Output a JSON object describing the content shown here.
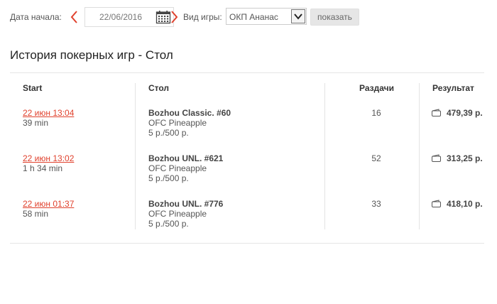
{
  "filter": {
    "start_date_label": "Дата начала:",
    "start_date_value": "22/06/2016",
    "game_type_label": "Вид игры:",
    "game_type_value": "ОКП Ананас",
    "show_button": "показать",
    "accent_color": "#e0412d"
  },
  "page": {
    "title": "История покерных игр - Стол"
  },
  "table": {
    "headers": {
      "start": "Start",
      "table": "Стол",
      "hands": "Раздачи",
      "result": "Результат"
    },
    "rows": [
      {
        "start": "22 июн 13:04",
        "duration": "39 min",
        "table_name": "Bozhou Classic. #60",
        "game": "OFC Pineapple",
        "stakes": "5 р./500 р.",
        "hands": "16",
        "result": "479,39 р."
      },
      {
        "start": "22 июн 13:02",
        "duration": "1 h 34 min",
        "table_name": "Bozhou UNL. #621",
        "game": "OFC Pineapple",
        "stakes": "5 р./500 р.",
        "hands": "52",
        "result": "313,25 р."
      },
      {
        "start": "22 июн 01:37",
        "duration": "58 min",
        "table_name": "Bozhou UNL. #776",
        "game": "OFC Pineapple",
        "stakes": "5 р./500 р.",
        "hands": "33",
        "result": "418,10 р."
      }
    ]
  }
}
